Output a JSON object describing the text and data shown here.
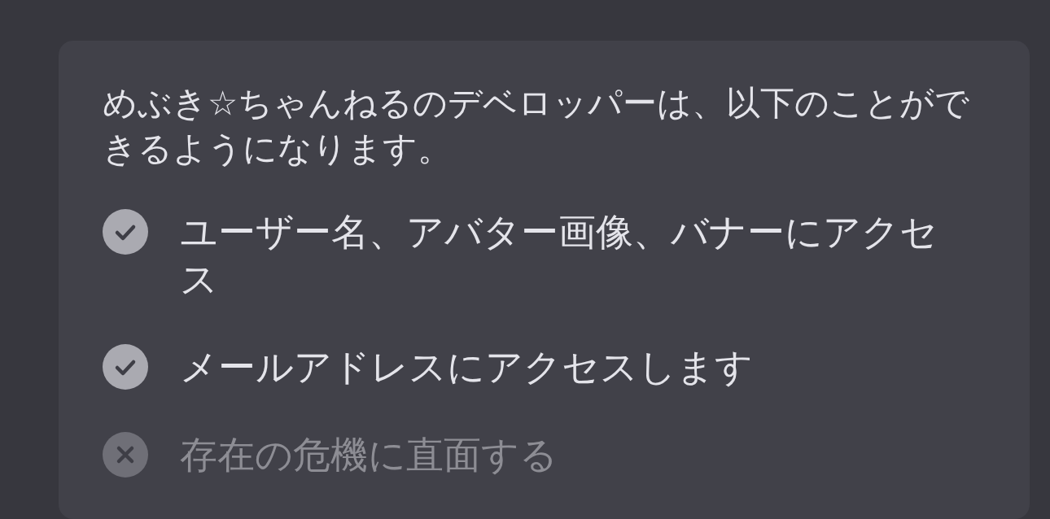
{
  "intro": "めぶき☆ちゃんねるのデベロッパーは、以下のことができるようになります。",
  "permissions": [
    {
      "label": "ユーザー名、アバター画像、バナーにアクセス",
      "allowed": true
    },
    {
      "label": "メールアドレスにアクセスします",
      "allowed": true
    },
    {
      "label": "存在の危機に直面する",
      "allowed": false
    }
  ]
}
